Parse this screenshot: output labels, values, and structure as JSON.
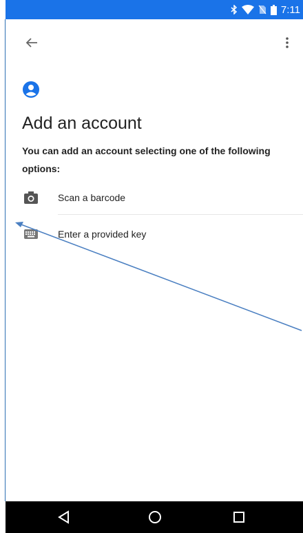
{
  "status_bar": {
    "time": "7:11",
    "icons": [
      "bluetooth-icon",
      "wifi-icon",
      "no-sim-icon",
      "battery-icon"
    ],
    "background_color": "#1a73e8"
  },
  "app_bar": {
    "back_icon": "back-arrow-icon",
    "menu_icon": "more-vert-icon"
  },
  "content": {
    "account_icon": "account-circle-icon",
    "title": "Add an account",
    "description": "You can add an account selecting one of the following options:",
    "options": [
      {
        "label": "Scan a barcode",
        "icon": "camera-icon"
      },
      {
        "label": "Enter a provided key",
        "icon": "keyboard-icon"
      }
    ]
  },
  "nav_bar": {
    "buttons": [
      "back-triangle-icon",
      "home-circle-icon",
      "recents-square-icon"
    ]
  },
  "annotation": {
    "color": "#4a7fc1"
  }
}
